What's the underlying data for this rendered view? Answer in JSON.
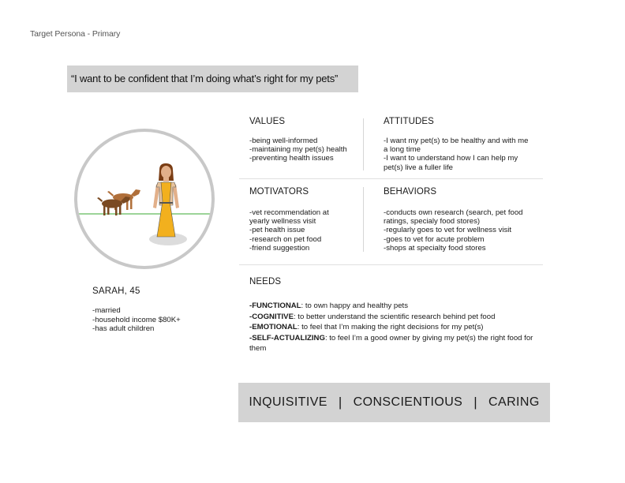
{
  "page_label": "Target Persona - Primary",
  "quote": "“I want to be confident that I’m doing what’s right for my pets”",
  "persona": {
    "name": "SARAH, 45",
    "facts": [
      "-married",
      "-household income $80K+",
      "-has adult children"
    ]
  },
  "values": {
    "title": "VALUES",
    "items": [
      "-being well-informed",
      "-maintaining my pet(s) health",
      "-preventing health issues"
    ]
  },
  "attitudes": {
    "title": "ATTITUDES",
    "items": [
      "-I want my pet(s) to be healthy and with me",
      "a long time",
      "-I want to understand how I can help my",
      "pet(s) live a fuller life"
    ]
  },
  "motivators": {
    "title": "MOTIVATORS",
    "items": [
      "-vet recommendation at",
      "yearly wellness visit",
      "-pet health issue",
      "-research on pet food",
      "-friend suggestion"
    ]
  },
  "behaviors": {
    "title": "BEHAVIORS",
    "items": [
      "-conducts own research (search, pet food",
      "ratings, specialy food stores)",
      "-regularly goes to vet for wellness visit",
      "-goes to vet for acute problem",
      "-shops at specialty food stores"
    ]
  },
  "needs": {
    "title": "NEEDS",
    "items": [
      {
        "label": "-FUNCTIONAL",
        "text": ": to own happy and healthy pets"
      },
      {
        "label": "-COGNITIVE",
        "text": ": to better understand the scientific research behind pet food"
      },
      {
        "label": "-EMOTIONAL",
        "text": ": to feel that I’m making the right decisions for my pet(s)"
      },
      {
        "label": "-SELF-ACTUALIZING",
        "text": ": to feel I’m a good owner by giving my pet(s) the right food for them"
      }
    ]
  },
  "traits": {
    "items": [
      "INQUISITIVE",
      "CONSCIENTIOUS",
      "CARING"
    ],
    "separator": "|"
  },
  "colors": {
    "box_gray": "#d3d3d3",
    "dress_yellow": "#f2b01e",
    "dog_brown": "#8b5a2b",
    "ground_green": "#7cc576"
  }
}
